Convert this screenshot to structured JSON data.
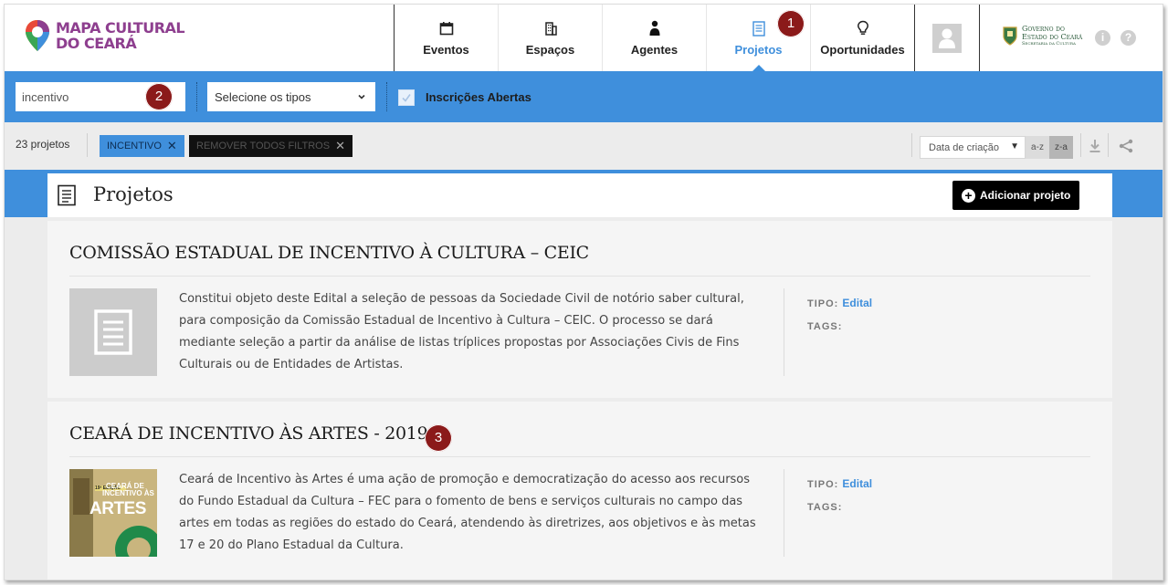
{
  "header": {
    "logo_line1": "MAPA CULTURAL",
    "logo_line2": "DO CEARÁ",
    "nav": [
      {
        "label": "Eventos",
        "icon": "calendar-icon"
      },
      {
        "label": "Espaços",
        "icon": "building-icon"
      },
      {
        "label": "Agentes",
        "icon": "person-icon"
      },
      {
        "label": "Projetos",
        "icon": "document-icon",
        "active": true
      },
      {
        "label": "Oportunidades",
        "icon": "lightbulb-icon"
      }
    ],
    "gov_line1": "Governo do",
    "gov_line2": "Estado do Ceará",
    "gov_line3": "Secretaria da Cultura",
    "info_icon": "i",
    "help_icon": "?"
  },
  "filters": {
    "search_value": "incentivo",
    "type_select": "Selecione os tipos",
    "checkbox_label": "Inscrições Abertas",
    "checkbox_checked": true
  },
  "results": {
    "count": "23 projetos",
    "active_filter": "INCENTIVO",
    "remove_all": "REMOVER TODOS FILTROS",
    "sort_by": "Data de criação",
    "sort_az": "a-z",
    "sort_za": "z-a"
  },
  "page": {
    "title": "Projetos",
    "add_button": "Adicionar projeto"
  },
  "projects": [
    {
      "title": "COMISSÃO ESTADUAL DE INCENTIVO À CULTURA – CEIC",
      "description": "Constitui objeto deste Edital a seleção de pessoas da Sociedade Civil de notório saber cultural, para composição da Comissão Estadual de Incentivo à Cultura – CEIC. O processo se dará mediante seleção a partir da análise de listas tríplices propostas por Associações Civis de Fins Culturais ou de Entidades de Artistas.",
      "tipo_label": "TIPO:",
      "tipo_value": "Edital",
      "tags_label": "TAGS:"
    },
    {
      "title": "CEARÁ DE INCENTIVO ÀS ARTES - 2019",
      "description": "Ceará de Incentivo às Artes é uma ação de promoção e democratização do acesso aos recursos do Fundo Estadual da Cultura – FEC para o fomento de bens e serviços culturais no campo das artes em todas as regiões do estado do Ceará, atendendo às diretrizes, aos objetivos e às metas 17 e 20 do Plano Estadual da Cultura.",
      "tipo_label": "TIPO:",
      "tipo_value": "Edital",
      "tags_label": "TAGS:",
      "thumb_text_1": "19ª EDIÇÃO",
      "thumb_text_2": "CEARÁ DE",
      "thumb_text_3": "INCENTIVO ÀS",
      "thumb_text_4": "ARTES"
    }
  ],
  "markers": [
    "1",
    "2",
    "3"
  ],
  "colors": {
    "accent": "#3f8fdc",
    "brand": "#8e3f8f",
    "marker": "#8b1a1a"
  }
}
